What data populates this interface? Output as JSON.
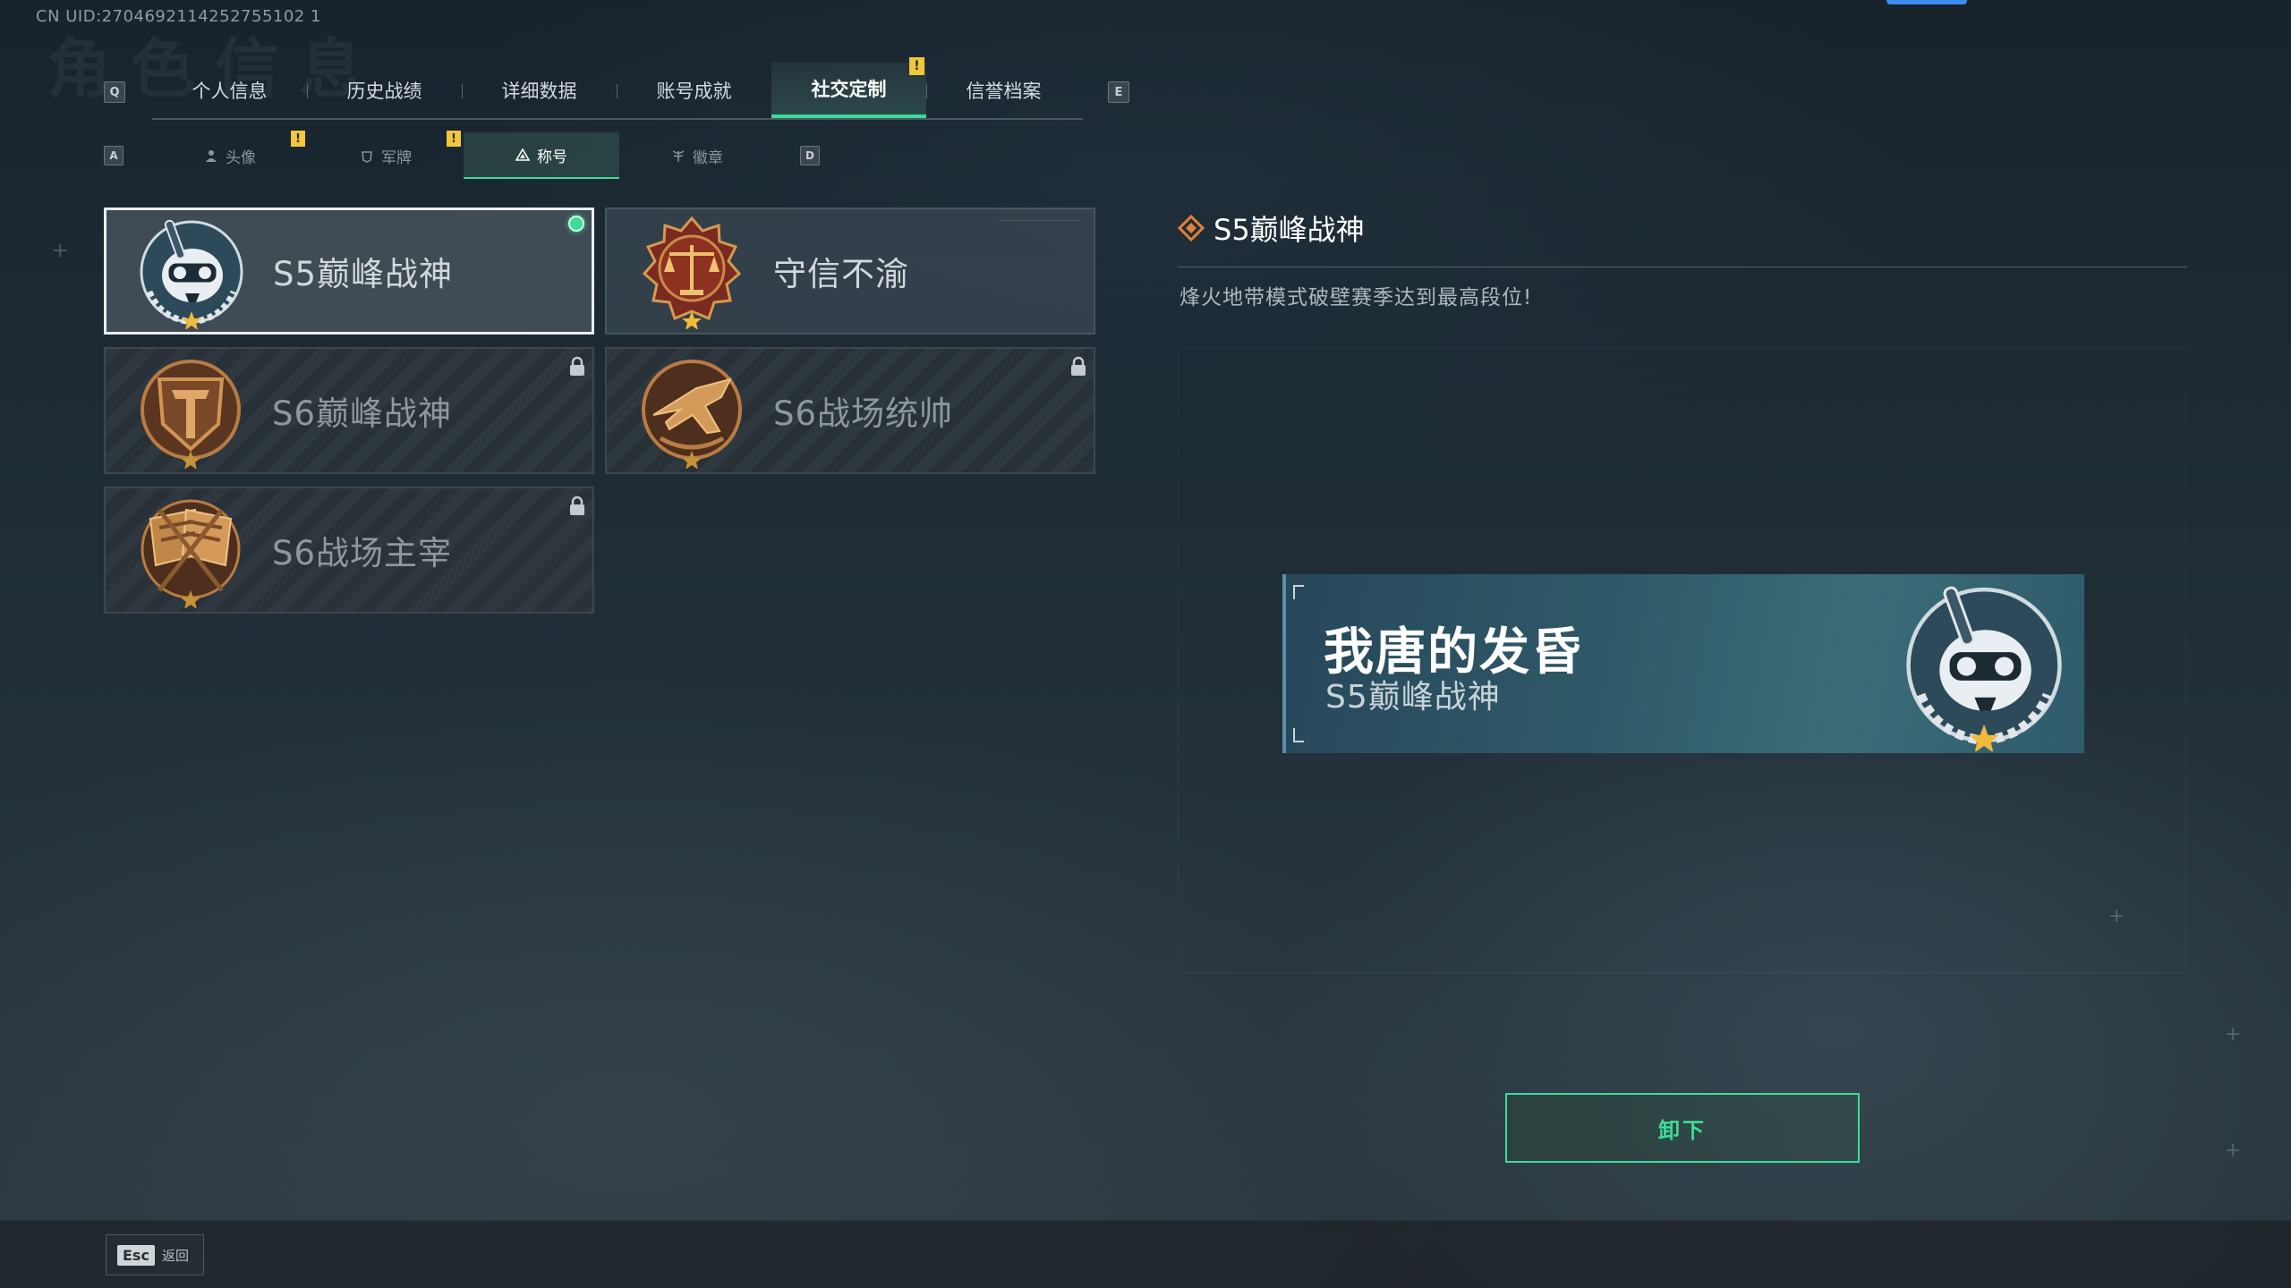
{
  "uid": "CN UID:2704692114252755102 1",
  "bg_title": "角色信息",
  "main_tabs": {
    "prev_key": "Q",
    "next_key": "E",
    "items": [
      {
        "label": "个人信息"
      },
      {
        "label": "历史战绩"
      },
      {
        "label": "详细数据"
      },
      {
        "label": "账号成就"
      },
      {
        "label": "社交定制"
      },
      {
        "label": "信誉档案"
      }
    ],
    "active_index": 4,
    "alert_glyph": "!"
  },
  "sub_tabs": {
    "prev_key": "A",
    "next_key": "D",
    "items": [
      {
        "label": "头像",
        "icon": "person-icon"
      },
      {
        "label": "军牌",
        "icon": "dogtag-icon"
      },
      {
        "label": "称号",
        "icon": "triangle-icon"
      },
      {
        "label": "徽章",
        "icon": "wing-icon"
      }
    ],
    "active_index": 2
  },
  "titles": [
    {
      "label": "S5巅峰战神",
      "medal": "diver-skull-medal-icon",
      "state": "equipped"
    },
    {
      "label": "守信不渝",
      "medal": "scales-medal-icon",
      "state": "unlocked"
    },
    {
      "label": "S6巅峰战神",
      "medal": "shield-t-medal-icon",
      "state": "locked"
    },
    {
      "label": "S6战场统帅",
      "medal": "jet-medal-icon",
      "state": "locked"
    },
    {
      "label": "S6战场主宰",
      "medal": "crossed-flags-medal-icon",
      "state": "locked"
    }
  ],
  "detail": {
    "title": "S5巅峰战神",
    "description": "烽火地带模式破壁赛季达到最高段位!"
  },
  "preview": {
    "player_name": "我唐的发昏",
    "title": "S5巅峰战神"
  },
  "actions": {
    "unequip_label": "卸下"
  },
  "footer": {
    "esc_key": "Esc",
    "back_label": "返回"
  },
  "colors": {
    "accent_green": "#3ddc97",
    "alert_yellow": "#f0c63a",
    "preview_bg": "#2f5968",
    "top_accent_blue": "#3d8cf0"
  }
}
